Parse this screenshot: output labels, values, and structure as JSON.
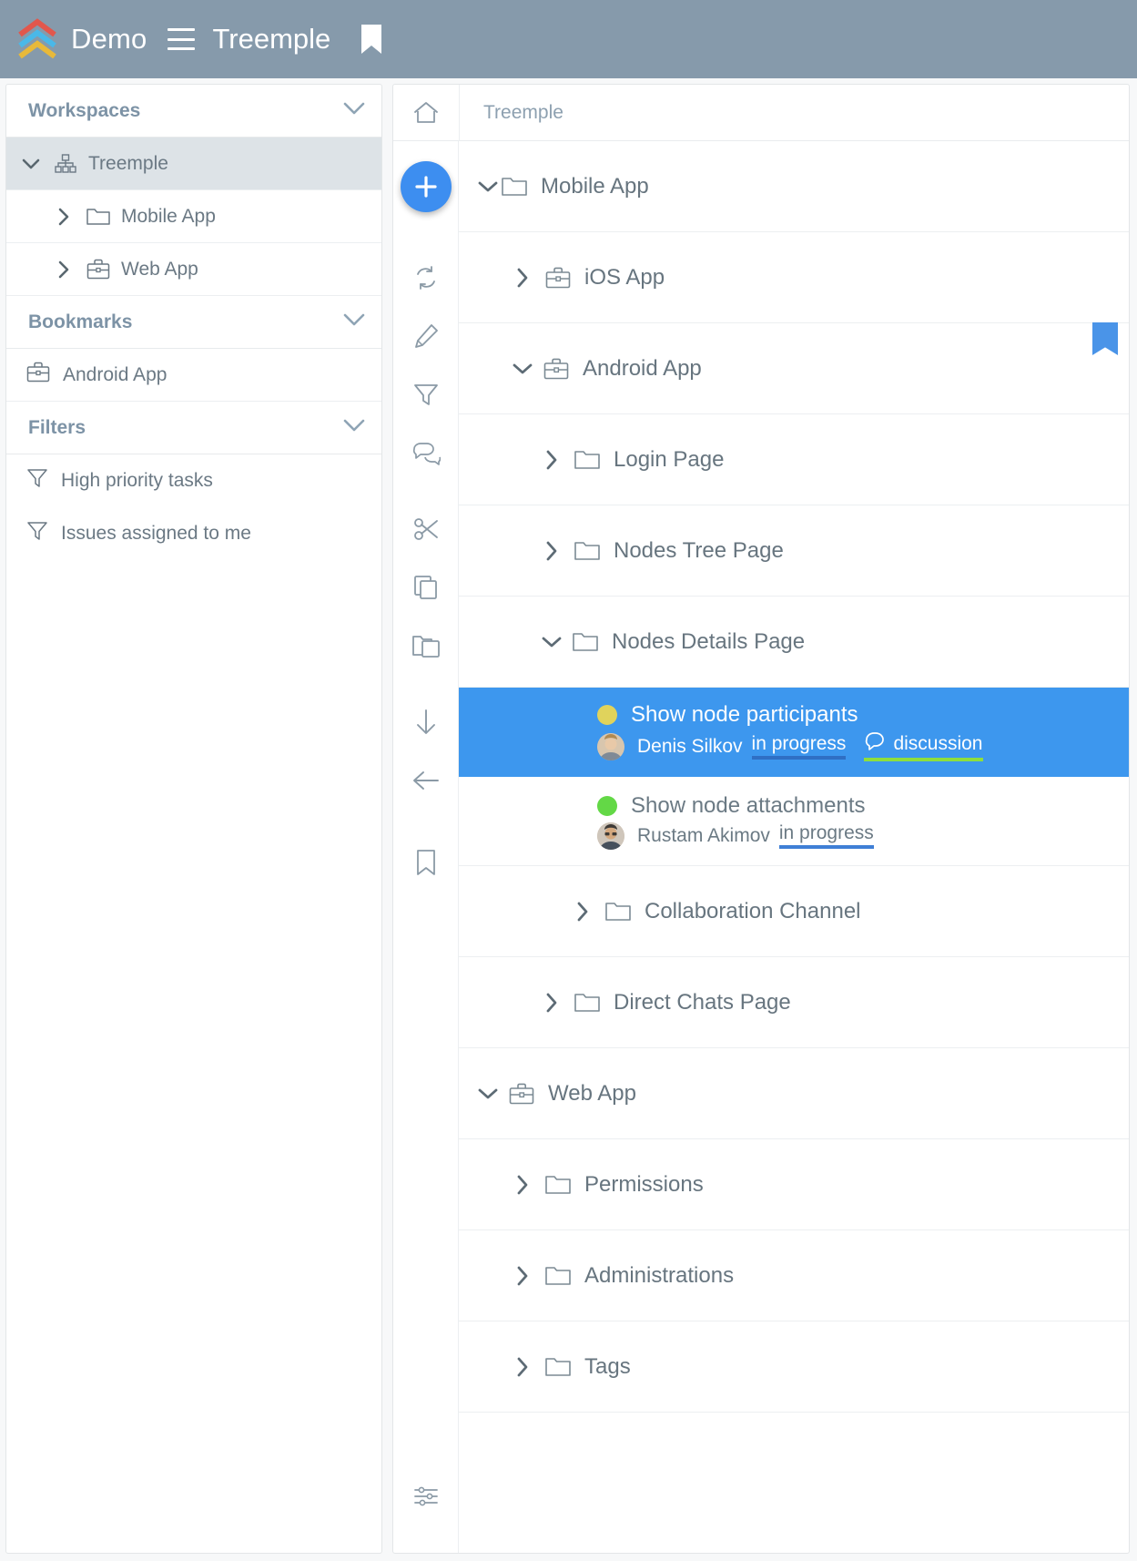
{
  "header": {
    "logo_icon": "treemple-chevrons-logo",
    "brand": "Demo",
    "menu_icon": "hamburger-menu-icon",
    "workspace": "Treemple",
    "bookmark_icon": "bookmark-icon"
  },
  "sidebar": {
    "sections": [
      {
        "title": "Workspaces",
        "collapse_icon": "chevron-down-icon"
      },
      {
        "title": "Bookmarks",
        "collapse_icon": "chevron-down-icon"
      },
      {
        "title": "Filters",
        "collapse_icon": "chevron-down-icon"
      }
    ],
    "workspaces": [
      {
        "label": "Treemple",
        "icon": "sitemap-icon",
        "caret": "chevron-down-icon",
        "selected": true,
        "depth": 0
      },
      {
        "label": "Mobile App",
        "icon": "folder-icon",
        "caret": "chevron-right-icon",
        "selected": false,
        "depth": 1
      },
      {
        "label": "Web App",
        "icon": "briefcase-icon",
        "caret": "chevron-right-icon",
        "selected": false,
        "depth": 1
      }
    ],
    "bookmarks": [
      {
        "label": "Android App",
        "icon": "briefcase-icon"
      }
    ],
    "filters": [
      {
        "label": "High priority tasks",
        "icon": "filter-icon"
      },
      {
        "label": "Issues assigned to me",
        "icon": "filter-icon"
      }
    ]
  },
  "breadcrumb": {
    "home_icon": "home-icon",
    "path": "Treemple"
  },
  "toolbar": {
    "add_label": "+",
    "add_icon": "plus-icon",
    "icons": [
      "refresh-icon",
      "pencil-icon",
      "filter-icon",
      "comments-icon",
      "scissors-icon",
      "copy-icon",
      "paste-folder-icon",
      "arrow-down-icon",
      "arrow-left-icon",
      "bookmark-icon"
    ],
    "settings_icon": "sliders-settings-icon"
  },
  "tree": {
    "nodes": [
      {
        "label": "Mobile App",
        "icon": "folder-icon",
        "caret": "chevron-down-icon",
        "depth": 0,
        "type": "node"
      },
      {
        "label": "iOS App",
        "icon": "briefcase-icon",
        "caret": "chevron-right-icon",
        "depth": 1,
        "type": "node"
      },
      {
        "label": "Android App",
        "icon": "briefcase-icon",
        "caret": "chevron-down-icon",
        "depth": 1,
        "type": "node",
        "bookmarked": true
      },
      {
        "label": "Login Page",
        "icon": "folder-icon",
        "caret": "chevron-right-icon",
        "depth": 2,
        "type": "node"
      },
      {
        "label": "Nodes Tree Page",
        "icon": "folder-icon",
        "caret": "chevron-right-icon",
        "depth": 2,
        "type": "node"
      },
      {
        "label": "Nodes Details Page",
        "icon": "folder-icon",
        "caret": "chevron-down-icon",
        "depth": 2,
        "type": "node"
      },
      {
        "label": "Collaboration Channel",
        "icon": "folder-icon",
        "caret": "chevron-right-icon",
        "depth": 3,
        "type": "node"
      },
      {
        "label": "Direct Chats Page",
        "icon": "folder-icon",
        "caret": "chevron-right-icon",
        "depth": 2,
        "type": "node"
      },
      {
        "label": "Web App",
        "icon": "briefcase-icon",
        "caret": "chevron-down-icon",
        "depth": 0,
        "type": "node"
      },
      {
        "label": "Permissions",
        "icon": "folder-icon",
        "caret": "chevron-right-icon",
        "depth": 1,
        "type": "node"
      },
      {
        "label": "Administrations",
        "icon": "folder-icon",
        "caret": "chevron-right-icon",
        "depth": 1,
        "type": "node"
      },
      {
        "label": "Tags",
        "icon": "folder-icon",
        "caret": "chevron-right-icon",
        "depth": 1,
        "type": "node"
      }
    ],
    "tasks": [
      {
        "title": "Show node participants",
        "dot_color": "#e0d35c",
        "assignee": "Denis Silkov",
        "status": "in progress",
        "status_underline": "#3f7fd6",
        "discussion_label": "discussion",
        "discussion_icon": "chat-bubble-icon",
        "discussion_underline": "#8ede3e",
        "selected": true
      },
      {
        "title": "Show node attachments",
        "dot_color": "#63d846",
        "assignee": "Rustam Akimov",
        "status": "in progress",
        "status_underline": "#3f7fd6",
        "selected": false
      }
    ]
  },
  "colors": {
    "header_bg": "#869aab",
    "accent_blue": "#3d8ef0",
    "selection_blue": "#3d97ee",
    "section_title": "#7d93a6"
  }
}
